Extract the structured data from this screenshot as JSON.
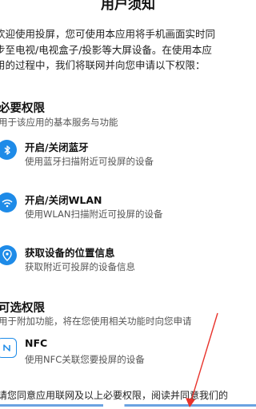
{
  "header": {
    "title": "用户须知"
  },
  "intro": {
    "lines": [
      "欢迎使用投屏，您可使用本应用将手机画面实时同",
      "步至电视/电视盒子/投影等大屏设备。在使用本应",
      "用的过程中，我们将联网并向您申请以下权限："
    ]
  },
  "required": {
    "title": "必要权限",
    "desc": "用于该应用的基本服务与功能",
    "items": [
      {
        "icon": "bluetooth-icon",
        "name": "开启/关闭蓝牙",
        "desc": "使用蓝牙扫描附近可投屏的设备"
      },
      {
        "icon": "wifi-icon",
        "name": "开启/关闭WLAN",
        "desc": "使用WLAN扫描附近可投屏的设备"
      },
      {
        "icon": "location-icon",
        "name": "获取设备的位置信息",
        "desc": "获取附近可投屏的设备信息"
      }
    ]
  },
  "optional": {
    "title": "可选权限",
    "desc": "用于附加功能，将在您使用相关功能时向您申请",
    "items": [
      {
        "icon": "nfc-icon",
        "name": "NFC",
        "desc": "使用NFC关联您要投屏的设备"
      }
    ]
  },
  "footer": {
    "text": "请您同意应用联网及以上必要权限，阅读并同意我们的"
  },
  "colors": {
    "accent": "#1e8be8",
    "annotation_arrow": "#e8322b"
  }
}
